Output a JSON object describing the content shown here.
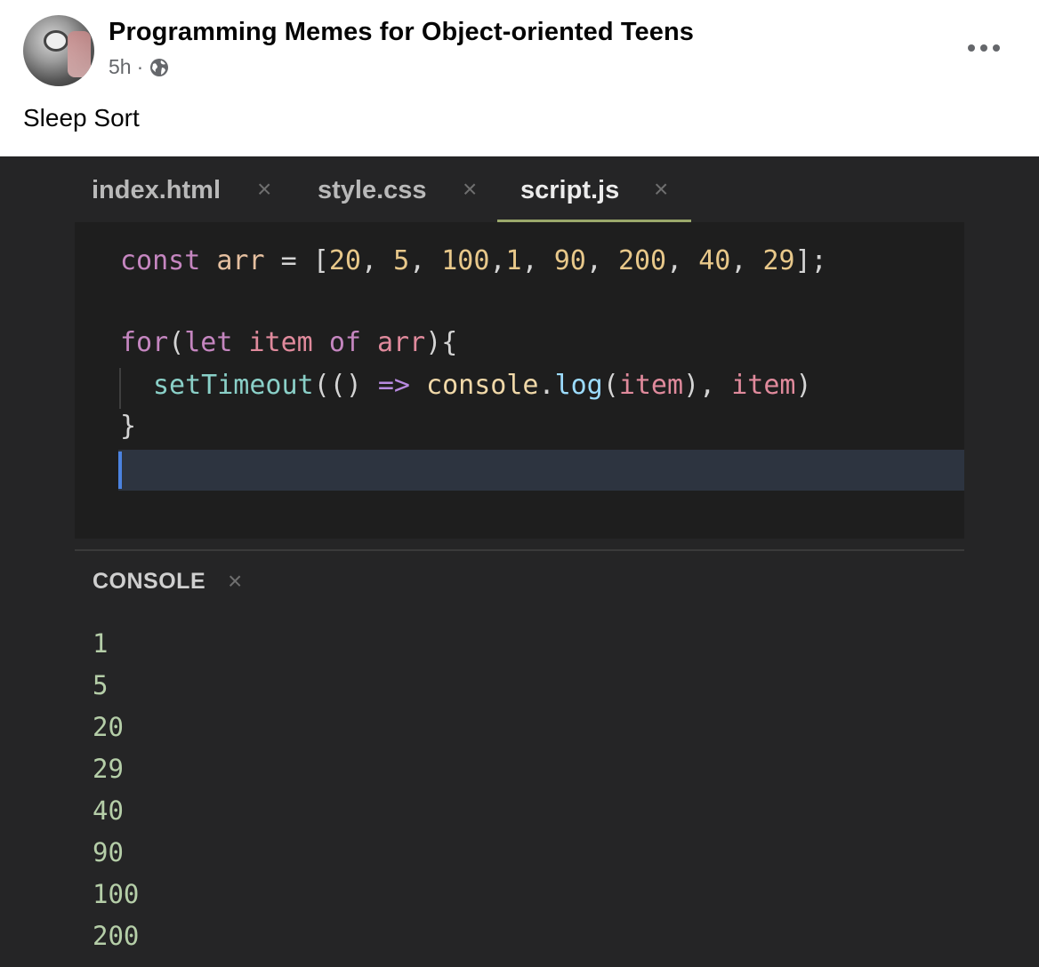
{
  "post": {
    "group_name": "Programming Memes for Object-oriented Teens",
    "time": "5h",
    "separator": "·",
    "audience_icon": "globe-icon",
    "text": "Sleep Sort",
    "more_icon": "more-options-icon"
  },
  "editor": {
    "tabs": [
      {
        "label": "index.html",
        "close": "×",
        "active": false
      },
      {
        "label": "style.css",
        "close": "×",
        "active": false
      },
      {
        "label": "script.js",
        "close": "×",
        "active": true
      }
    ],
    "code": {
      "l1": {
        "kw": "const",
        "name": "arr",
        "eq": "=",
        "open": "[",
        "n1": "20",
        "c1": ",",
        "n2": "5",
        "c2": ",",
        "n3": "100",
        "c3": ",",
        "n4": "1",
        "c4": ",",
        "n5": "90",
        "c5": ",",
        "n6": "200",
        "c6": ",",
        "n7": "40",
        "c7": ",",
        "n8": "29",
        "close": "];"
      },
      "l2": {
        "kw1": "for",
        "p1": "(",
        "kw2": "let",
        "v1": "item",
        "kw3": "of",
        "v2": "arr",
        "p2": "){"
      },
      "l3": {
        "fn": "setTimeout",
        "p1": "(()",
        "arrow": "=>",
        "obj": "console",
        "dot": ".",
        "method": "log",
        "p2": "(",
        "v1": "item",
        "p3": "),",
        "v2": "item",
        "p4": ")"
      },
      "l4": {
        "brace": "}"
      }
    }
  },
  "console": {
    "title": "CONSOLE",
    "close": "×",
    "output": [
      "1",
      "5",
      "20",
      "29",
      "40",
      "90",
      "100",
      "200"
    ]
  }
}
